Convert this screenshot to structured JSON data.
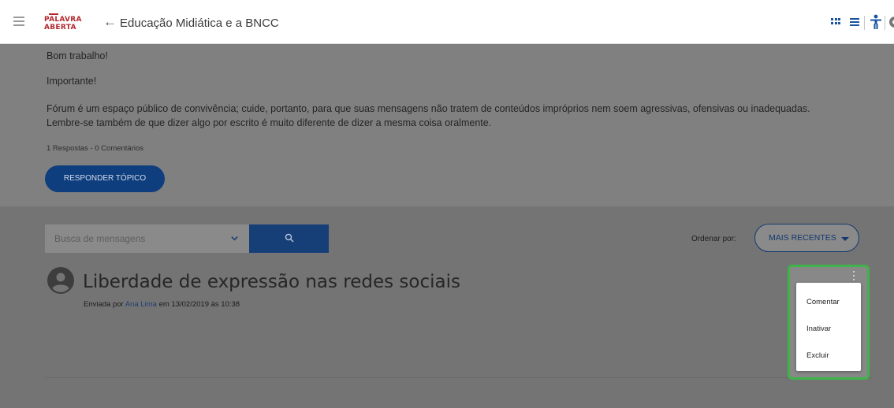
{
  "header": {
    "logo_line1": "PALAVRA",
    "logo_line2": "ABERTA",
    "back_icon": "arrow-left-icon",
    "course_title": "Educação Midiática e a BNCC",
    "icons": [
      "menu-icon",
      "grid-view-icon",
      "list-view-icon",
      "accessibility-icon",
      "settings-icon"
    ]
  },
  "topic": {
    "greeting": "Bom trabalho!",
    "important": "Importante!",
    "notice_line1": "Fórum é um espaço público de convivência; cuide, portanto, para que suas mensagens não tratem de conteúdos impróprios nem soem agressivas, ofensivas ou inadequadas.",
    "notice_line2": "Lembre-se também de que dizer algo por escrito é muito diferente de dizer a mesma coisa oralmente.",
    "counts": "1 Respostas - 0 Comentários",
    "reply_button": "RESPONDER TÓPICO"
  },
  "search": {
    "placeholder": "Busca de mensagens"
  },
  "order": {
    "label": "Ordenar por:",
    "selected": "MAIS RECENTES"
  },
  "post": {
    "title": "Liberdade de expressão nas redes sociais",
    "sent_by": "Enviada por",
    "author": "Ana Lima",
    "date_text": "em 13/02/2019 às 10:38"
  },
  "context_menu": {
    "items": [
      "Comentar",
      "Inativar",
      "Excluir"
    ]
  },
  "colors": {
    "primary": "#0e3e7e",
    "brand_red": "#b3282d",
    "highlight": "#3fb44a",
    "overlay": "#808080"
  }
}
